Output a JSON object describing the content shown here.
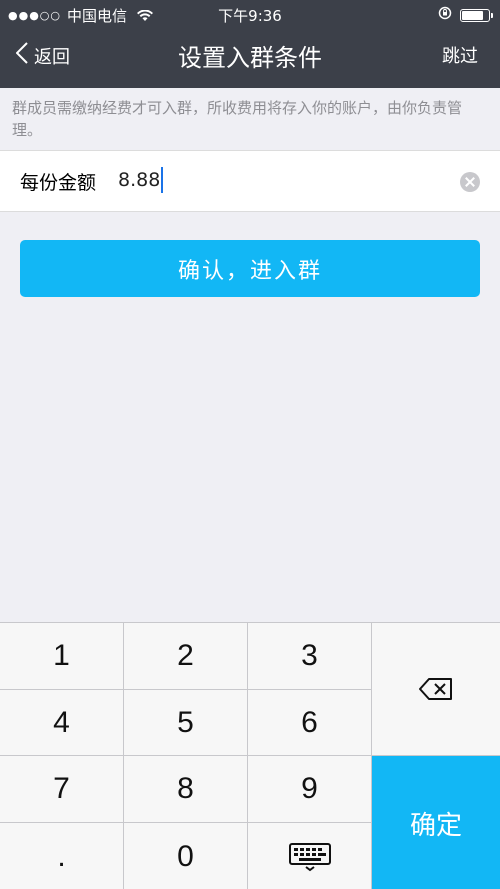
{
  "status_bar": {
    "signal_dots": "●●●○○",
    "carrier": "中国电信",
    "time": "下午9:36"
  },
  "nav": {
    "back_label": "返回",
    "title": "设置入群条件",
    "skip_label": "跳过"
  },
  "hint_text": "群成员需缴纳经费才可入群，所收费用将存入你的账户，由你负责管理。",
  "amount": {
    "label": "每份金额",
    "value": "8.88"
  },
  "confirm_button": "确认，进入群",
  "keypad": {
    "keys": [
      "1",
      "2",
      "3",
      "4",
      "5",
      "6",
      "7",
      "8",
      "9",
      ".",
      "0"
    ],
    "confirm_label": "确定",
    "icons": {
      "backspace": "backspace-icon",
      "keyboard": "keyboard-icon"
    }
  },
  "colors": {
    "header_bg": "#3c4049",
    "accent": "#12b7f5",
    "page_bg": "#efeff4"
  }
}
